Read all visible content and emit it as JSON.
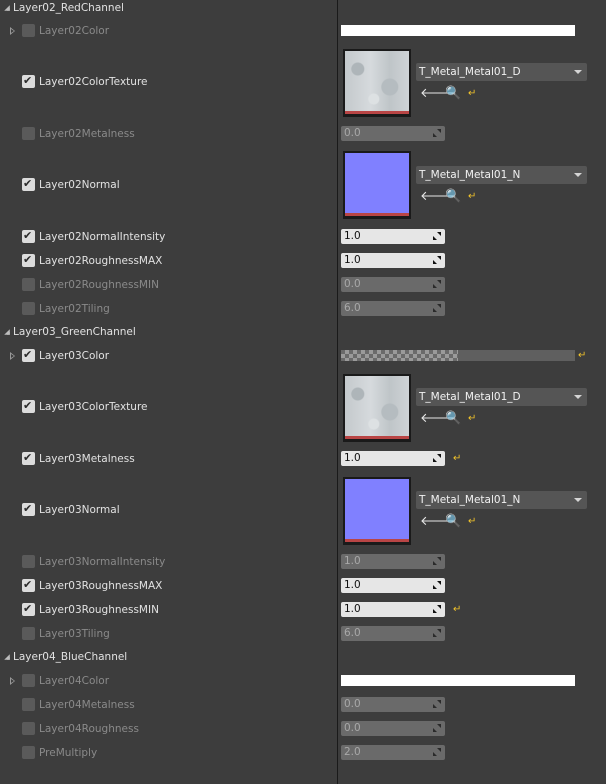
{
  "groups": {
    "red": "Layer02_RedChannel",
    "green": "Layer03_GreenChannel",
    "blue": "Layer04_BlueChannel"
  },
  "params": {
    "l2_color": "Layer02Color",
    "l2_color_texture": "Layer02ColorTexture",
    "l2_metalness": "Layer02Metalness",
    "l2_normal": "Layer02Normal",
    "l2_normal_intensity": "Layer02NormalIntensity",
    "l2_roughness_max": "Layer02RoughnessMAX",
    "l2_roughness_min": "Layer02RoughnessMIN",
    "l2_tiling": "Layer02Tiling",
    "l3_color": "Layer03Color",
    "l3_color_texture": "Layer03ColorTexture",
    "l3_metalness": "Layer03Metalness",
    "l3_normal": "Layer03Normal",
    "l3_normal_intensity": "Layer03NormalIntensity",
    "l3_roughness_max": "Layer03RoughnessMAX",
    "l3_roughness_min": "Layer03RoughnessMIN",
    "l3_tiling": "Layer03Tiling",
    "l4_color": "Layer04Color",
    "l4_metalness": "Layer04Metalness",
    "l4_roughness": "Layer04Roughness",
    "premultiply": "PreMultiply"
  },
  "values": {
    "l2_metalness": "0.0",
    "l2_normal_intensity": "1.0",
    "l2_roughness_max": "1.0",
    "l2_roughness_min": "0.0",
    "l2_tiling": "6.0",
    "l3_metalness": "1.0",
    "l3_normal_intensity": "1.0",
    "l3_roughness_max": "1.0",
    "l3_roughness_min": "1.0",
    "l3_tiling": "6.0",
    "l4_metalness": "0.0",
    "l4_roughness": "0.0",
    "premultiply": "2.0"
  },
  "assets": {
    "l2_color_texture": "T_Metal_Metal01_D",
    "l2_normal": "T_Metal_Metal01_N",
    "l3_color_texture": "T_Metal_Metal01_D",
    "l3_normal": "T_Metal_Metal01_N"
  },
  "icons": {
    "use_selected": "arrow-left-icon",
    "browse": "search-icon",
    "reset": "reset-to-default-icon",
    "expand": "triangle-right-icon",
    "collapse": "triangle-down-icon"
  },
  "colors": {
    "background": "#3d3d3d",
    "normal_map": "#8080ff",
    "reset_yellow": "#f1c32a",
    "texture_strip": "#b94545"
  }
}
